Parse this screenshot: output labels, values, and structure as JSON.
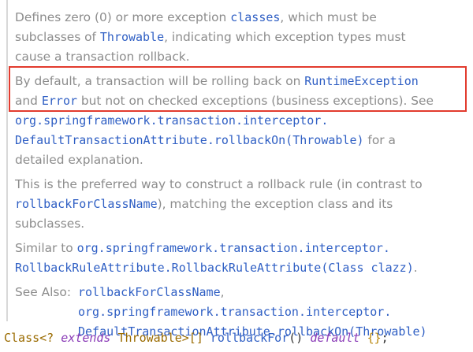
{
  "doc": {
    "p1": {
      "t1": "Defines zero (0) or more exception ",
      "c1": "classes",
      "t2": ", which must be",
      "t3": "subclasses of ",
      "c2": "Throwable",
      "t4": ", indicating which exception types must",
      "t5": "cause a transaction rollback."
    },
    "p2": {
      "t1": "By default, a transaction will be rolling back on ",
      "c1": "RuntimeException",
      "t2": "and ",
      "c2": "Error",
      "t3": " but not on checked exceptions (business exceptions). See",
      "c3": "org.springframework.transaction.interceptor.",
      "c4": "DefaultTransactionAttribute.rollbackOn(Throwable)",
      "t4": " for a",
      "t5": "detailed explanation."
    },
    "p3": {
      "t1": "This is the preferred way to construct a rollback rule (in contrast to",
      "c1": "rollbackForClassName",
      "t2": "), matching the exception class and its",
      "t3": "subclasses."
    },
    "p4": {
      "t1": "Similar to ",
      "c1": "org.springframework.transaction.interceptor.",
      "c2": "RollbackRuleAttribute.RollbackRuleAttribute(Class clazz)",
      "t2": "."
    },
    "see_also": {
      "label": "See Also:",
      "l1": "rollbackForClassName",
      "l1_suffix": ",",
      "l2": "org.springframework.transaction.interceptor.",
      "l3": "DefaultTransactionAttribute.rollbackOn(Throwable)"
    }
  },
  "declaration": {
    "type": "Class<? ",
    "kw1": "extends",
    "type2": " Throwable>[] ",
    "name": "rollbackFor",
    "parens": "() ",
    "kw2": "default",
    "space": " ",
    "braces": "{}",
    "semi": ";"
  },
  "colors": {
    "highlight_border": "#e23b2e",
    "code_link": "#2f5fc4",
    "doc_text": "#8c8c8c"
  }
}
